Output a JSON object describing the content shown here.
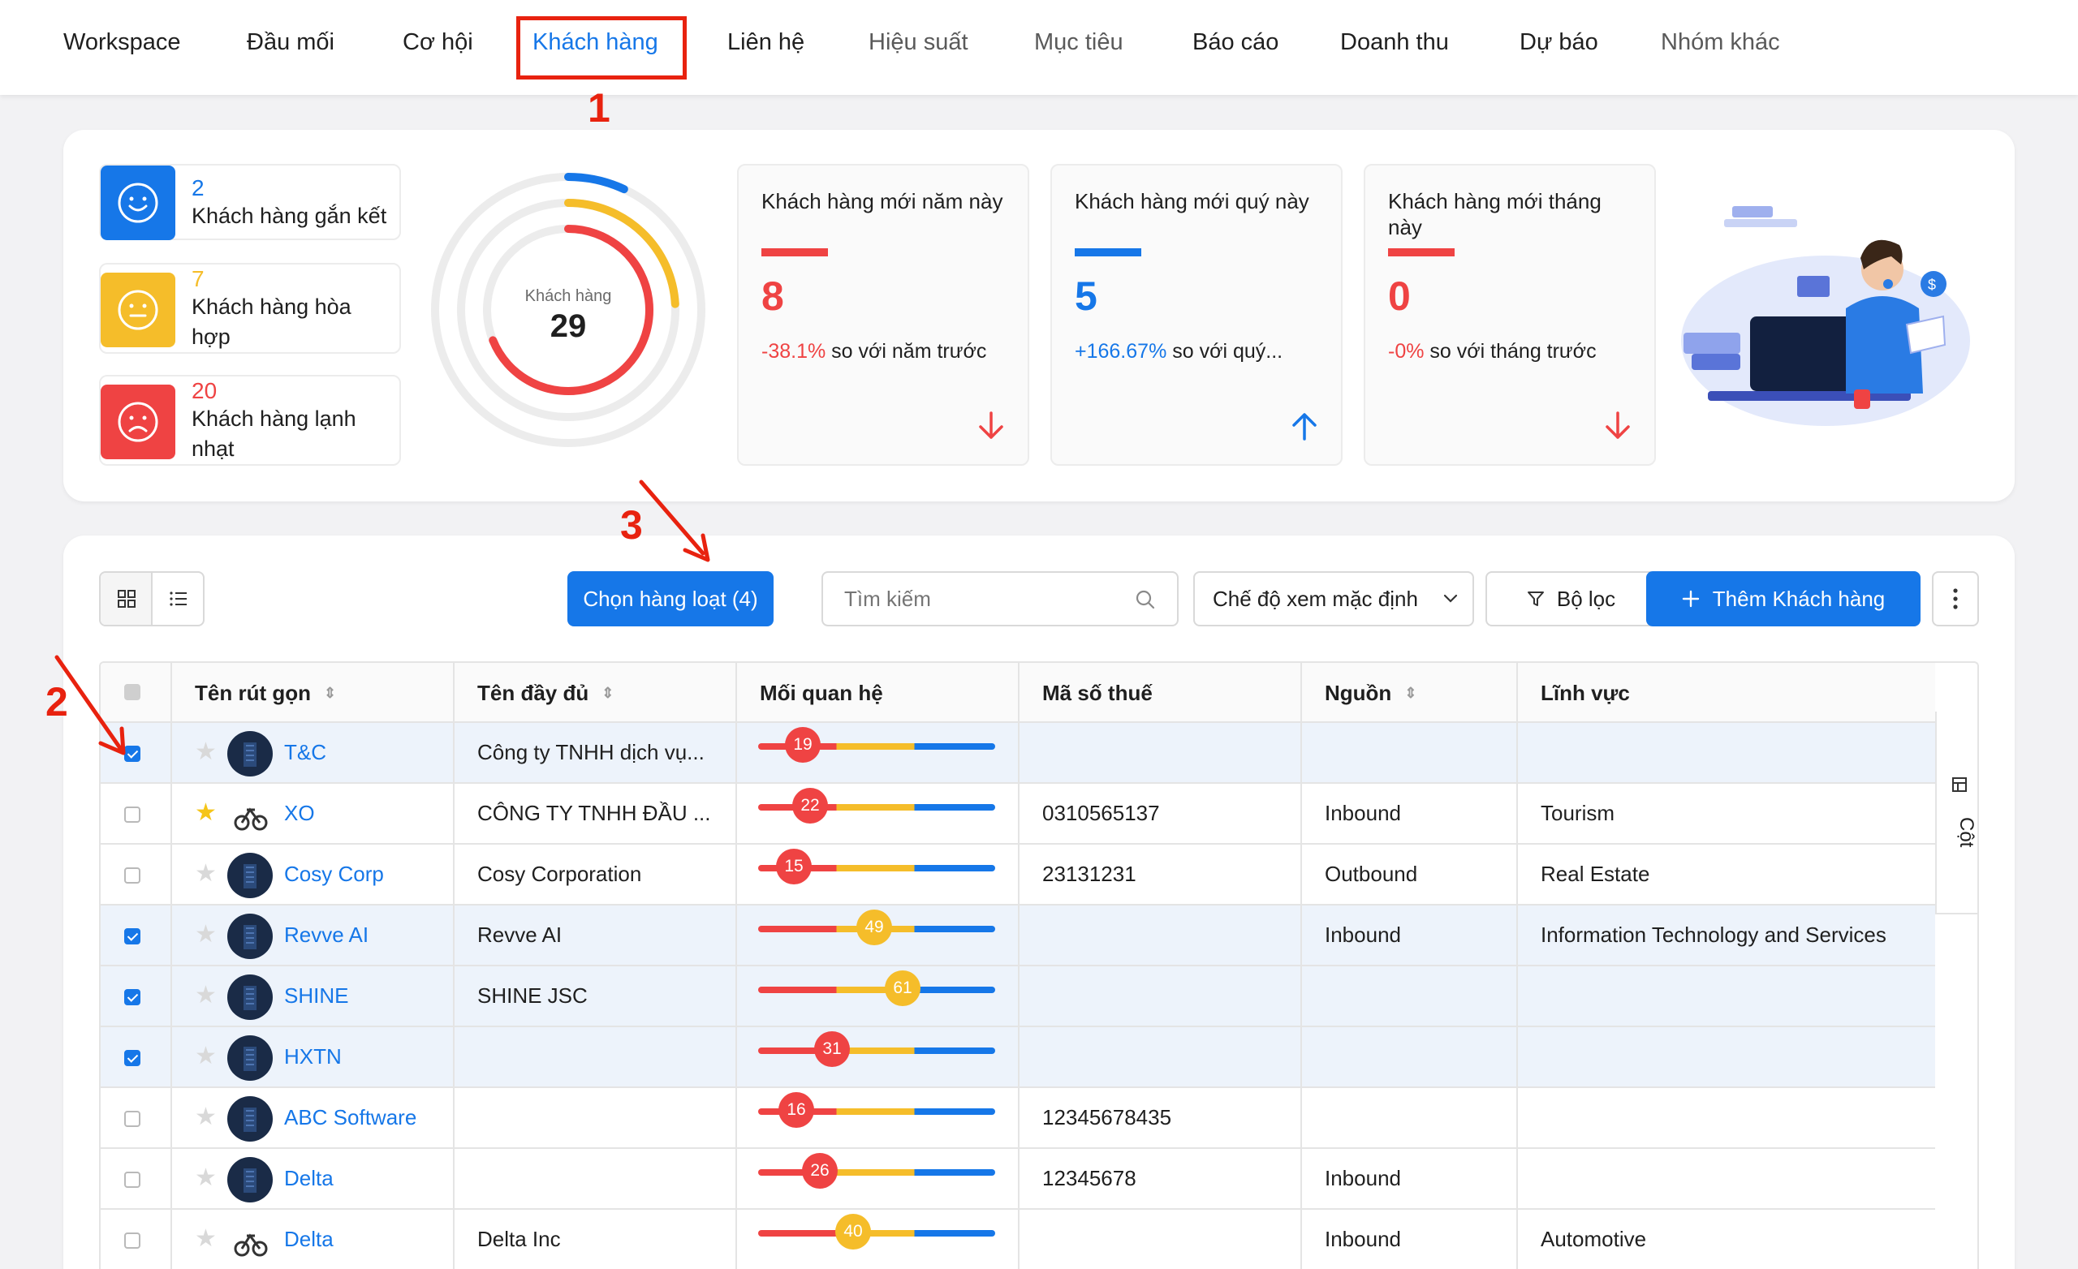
{
  "nav": {
    "items": [
      "Workspace",
      "Đầu mối",
      "Cơ hội",
      "Khách hàng",
      "Liên hệ",
      "Hiệu suất",
      "Mục tiêu",
      "Báo cáo",
      "Doanh thu",
      "Dự báo",
      "Nhóm khác"
    ],
    "active_index": 3
  },
  "annotations": [
    "1",
    "2",
    "3"
  ],
  "segments": [
    {
      "count": "2",
      "label": "Khách hàng gắn kết",
      "color": "#1677e8"
    },
    {
      "count": "7",
      "label": "Khách hàng hòa hợp",
      "color": "#f5bd2a"
    },
    {
      "count": "20",
      "label": "Khách hàng lạnh nhạt",
      "color": "#ef4343"
    }
  ],
  "ring": {
    "label": "Khách hàng",
    "total": "29",
    "parts": [
      {
        "value": 2,
        "color": "#1677e8"
      },
      {
        "value": 7,
        "color": "#f5bd2a"
      },
      {
        "value": 20,
        "color": "#ef4343"
      }
    ]
  },
  "kpis": [
    {
      "title": "Khách hàng mới năm này",
      "value": "8",
      "change": "-38.1%",
      "suffix": " so với năm trước",
      "color": "#ef4343",
      "direction": "down"
    },
    {
      "title": "Khách hàng mới quý này",
      "value": "5",
      "change": "+166.67%",
      "suffix": " so với quý...",
      "color": "#1677e8",
      "direction": "up"
    },
    {
      "title": "Khách hàng mới tháng này",
      "value": "0",
      "change": "-0%",
      "suffix": " so với tháng trước",
      "color": "#ef4343",
      "direction": "down"
    }
  ],
  "toolbar": {
    "bulk_select": "Chọn hàng loạt (4)",
    "search_placeholder": "Tìm kiếm",
    "view_mode": "Chế độ xem mặc định",
    "filter": "Bộ lọc",
    "add": "Thêm Khách hàng"
  },
  "table": {
    "columns": [
      "Tên rút gọn",
      "Tên đầy đủ",
      "Mối quan hệ",
      "Mã số thuế",
      "Nguồn",
      "Lĩnh vực"
    ],
    "side_label": "Cột",
    "rows": [
      {
        "selected": true,
        "starred": false,
        "logo": false,
        "short": "T&C",
        "full": "Công ty TNHH dịch vụ...",
        "score": 19,
        "tax": "",
        "source": "",
        "field": ""
      },
      {
        "selected": false,
        "starred": true,
        "logo": true,
        "short": "XO",
        "full": "CÔNG TY TNHH ĐẦU ...",
        "score": 22,
        "tax": "0310565137",
        "source": "Inbound",
        "field": "Tourism"
      },
      {
        "selected": false,
        "starred": false,
        "logo": false,
        "short": "Cosy Corp",
        "full": "Cosy Corporation",
        "score": 15,
        "tax": "23131231",
        "source": "Outbound",
        "field": "Real Estate"
      },
      {
        "selected": true,
        "starred": false,
        "logo": false,
        "short": "Revve AI",
        "full": "Revve AI",
        "score": 49,
        "tax": "",
        "source": "Inbound",
        "field": "Information Technology and Services"
      },
      {
        "selected": true,
        "starred": false,
        "logo": false,
        "short": "SHINE",
        "full": "SHINE JSC",
        "score": 61,
        "tax": "",
        "source": "",
        "field": ""
      },
      {
        "selected": true,
        "starred": false,
        "logo": false,
        "short": "HXTN",
        "full": "",
        "score": 31,
        "tax": "",
        "source": "",
        "field": ""
      },
      {
        "selected": false,
        "starred": false,
        "logo": false,
        "short": "ABC Software",
        "full": "",
        "score": 16,
        "tax": "12345678435",
        "source": "",
        "field": ""
      },
      {
        "selected": false,
        "starred": false,
        "logo": false,
        "short": "Delta",
        "full": "",
        "score": 26,
        "tax": "12345678",
        "source": "Inbound",
        "field": ""
      },
      {
        "selected": false,
        "starred": false,
        "logo": true,
        "short": "Delta",
        "full": "Delta Inc",
        "score": 40,
        "tax": "",
        "source": "Inbound",
        "field": "Automotive"
      }
    ]
  }
}
